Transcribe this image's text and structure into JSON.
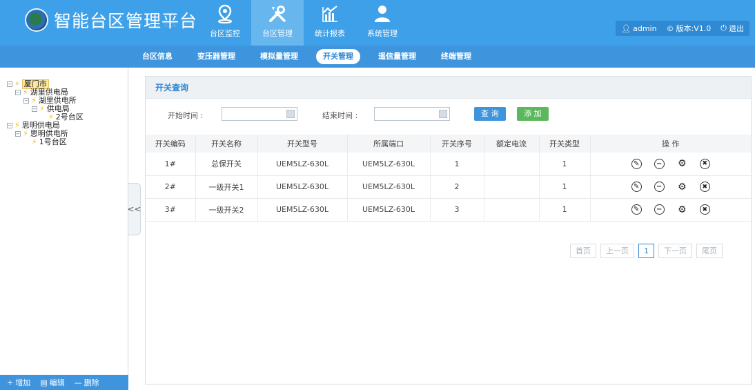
{
  "header": {
    "app_title": "智能台区管理平台",
    "nav": [
      {
        "label": "台区监控",
        "icon": "location-pin-icon"
      },
      {
        "label": "台区管理",
        "icon": "tools-icon"
      },
      {
        "label": "统计报表",
        "icon": "bar-chart-icon"
      },
      {
        "label": "系统管理",
        "icon": "user-icon"
      }
    ],
    "active_nav": "台区管理",
    "user": "admin",
    "version": "版本:V1.0",
    "logout": "退出"
  },
  "subnav": {
    "items": [
      "台区信息",
      "变压器管理",
      "模拟量管理",
      "开关管理",
      "遥信量管理",
      "终端管理"
    ],
    "active": "开关管理"
  },
  "tree": {
    "nodes": [
      {
        "label": "厦门市",
        "selected": true
      },
      {
        "label": "湖里供电局"
      },
      {
        "label": "湖里供电所"
      },
      {
        "label": "供电局"
      },
      {
        "label": "2号台区"
      },
      {
        "label": "思明供电局"
      },
      {
        "label": "思明供电所"
      },
      {
        "label": "1号台区"
      }
    ]
  },
  "sidebar_footer": {
    "add": "增加",
    "edit": "编辑",
    "delete": "删除"
  },
  "collapse_label": "<<",
  "panel": {
    "title": "开关查询",
    "start_label": "开始时间 :",
    "end_label": "结束时间 :",
    "query_btn": "查 询",
    "add_btn": "添 加"
  },
  "table": {
    "columns": [
      "开关编码",
      "开关名称",
      "开关型号",
      "所属端口",
      "开关序号",
      "额定电流",
      "开关类型",
      "操 作"
    ],
    "rows": [
      [
        "1#",
        "总保开关",
        "UEM5LZ-630L",
        "UEM5LZ-630L",
        "1",
        "",
        "1"
      ],
      [
        "2#",
        "一级开关1",
        "UEM5LZ-630L",
        "UEM5LZ-630L",
        "2",
        "",
        "1"
      ],
      [
        "3#",
        "一级开关2",
        "UEM5LZ-630L",
        "UEM5LZ-630L",
        "3",
        "",
        "1"
      ]
    ]
  },
  "pager": {
    "first": "首页",
    "prev": "上一页",
    "current": "1",
    "next": "下一页",
    "last": "尾页"
  }
}
